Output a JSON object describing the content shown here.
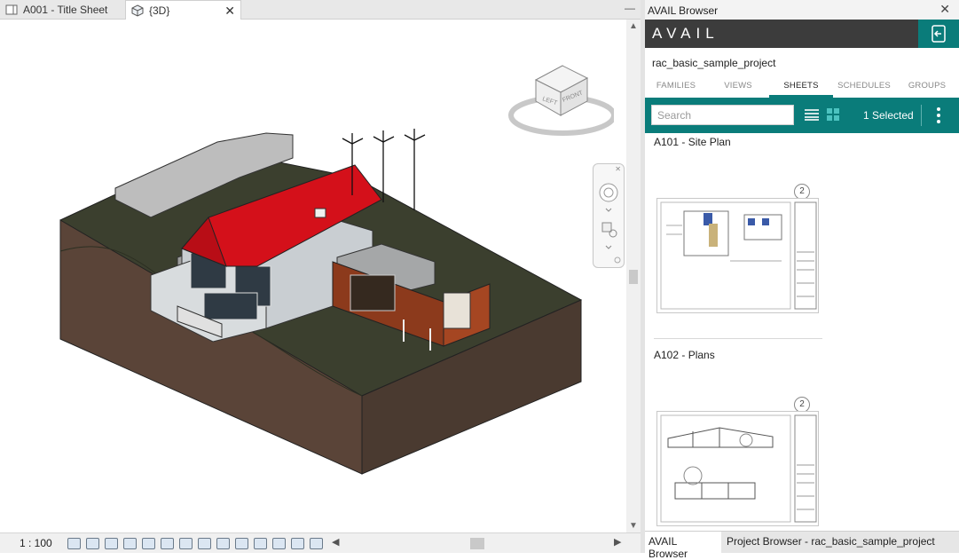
{
  "document_tabs": [
    {
      "label": "A001 - Title Sheet",
      "icon": "sheet-icon"
    },
    {
      "label": "{3D}",
      "icon": "3d-view-icon"
    }
  ],
  "view": {
    "scale": "1 : 100",
    "viewcube_faces": {
      "left": "LEFT",
      "front": "FRONT"
    }
  },
  "avail": {
    "panel_title": "AVAIL Browser",
    "brand": "AVAIL",
    "project_name": "rac_basic_sample_project",
    "tabs": [
      {
        "label": "FAMILIES",
        "active": false
      },
      {
        "label": "VIEWS",
        "active": false
      },
      {
        "label": "SHEETS",
        "active": true
      },
      {
        "label": "SCHEDULES",
        "active": false
      },
      {
        "label": "GROUPS",
        "active": false
      }
    ],
    "search": {
      "placeholder": "Search",
      "value": ""
    },
    "selected_count": "1 Selected",
    "accent_color": "#0a7c7a",
    "sheets": [
      {
        "title": "A101 - Site Plan",
        "count": "2"
      },
      {
        "title": "A102 - Plans",
        "count": "2"
      }
    ]
  },
  "bottom_tabs": [
    {
      "label": "AVAIL Browser",
      "active": true
    },
    {
      "label": "Project Browser - rac_basic_sample_project",
      "active": false
    }
  ]
}
